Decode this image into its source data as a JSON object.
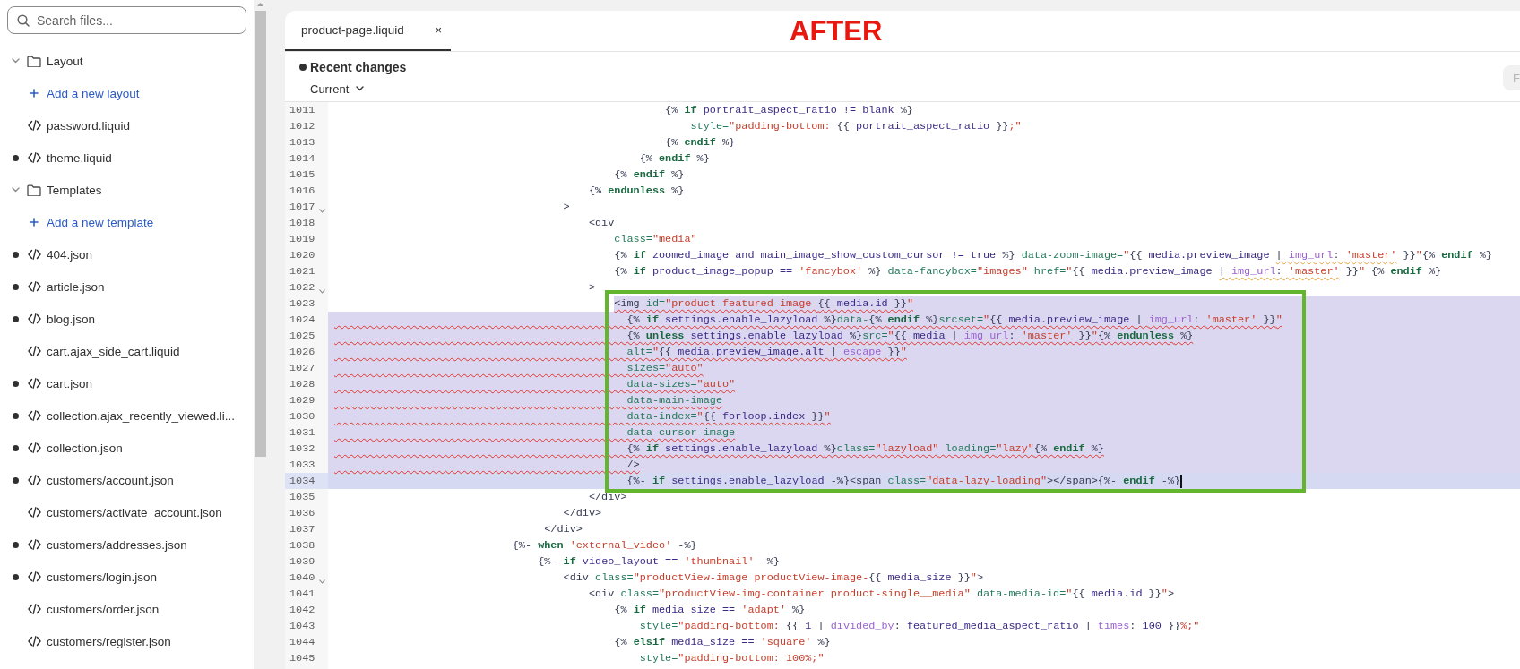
{
  "sidebar": {
    "search": {
      "placeholder": "Search files..."
    },
    "tree": [
      {
        "kind": "folder",
        "label": "Layout",
        "expanded": true,
        "children": [
          {
            "kind": "add",
            "label": "Add a new layout"
          },
          {
            "kind": "file",
            "label": "password.liquid",
            "modified": false
          },
          {
            "kind": "file",
            "label": "theme.liquid",
            "modified": true
          }
        ]
      },
      {
        "kind": "folder",
        "label": "Templates",
        "expanded": true,
        "children": [
          {
            "kind": "add",
            "label": "Add a new template"
          },
          {
            "kind": "file",
            "label": "404.json",
            "modified": true
          },
          {
            "kind": "file",
            "label": "article.json",
            "modified": true
          },
          {
            "kind": "file",
            "label": "blog.json",
            "modified": true
          },
          {
            "kind": "file",
            "label": "cart.ajax_side_cart.liquid",
            "modified": false
          },
          {
            "kind": "file",
            "label": "cart.json",
            "modified": true
          },
          {
            "kind": "file",
            "label": "collection.ajax_recently_viewed.li...",
            "modified": true
          },
          {
            "kind": "file",
            "label": "collection.json",
            "modified": true
          },
          {
            "kind": "file",
            "label": "customers/account.json",
            "modified": true
          },
          {
            "kind": "file",
            "label": "customers/activate_account.json",
            "modified": false
          },
          {
            "kind": "file",
            "label": "customers/addresses.json",
            "modified": true
          },
          {
            "kind": "file",
            "label": "customers/login.json",
            "modified": true
          },
          {
            "kind": "file",
            "label": "customers/order.json",
            "modified": false
          },
          {
            "kind": "file",
            "label": "customers/register.json",
            "modified": false
          }
        ]
      }
    ]
  },
  "editor": {
    "tabs": [
      {
        "label": "product-page.liquid",
        "close": "×",
        "selected": true
      }
    ],
    "annotation_label": "AFTER",
    "changes": {
      "unsaved": true,
      "title": "Recent changes",
      "version": "Current"
    },
    "toolbar_button": "F",
    "lines": [
      {
        "number": "1011",
        "current": false,
        "foldable": false,
        "selected": false,
        "partial": false,
        "squiggle": false,
        "tokens": [
          {
            "kind": "punct",
            "text": "                                                    {% "
          },
          {
            "kind": "keyword",
            "text": "if"
          },
          {
            "kind": "name",
            "text": " portrait_aspect_ratio != blank "
          },
          {
            "kind": "punct",
            "text": "%}"
          }
        ]
      },
      {
        "number": "1012",
        "current": false,
        "foldable": false,
        "selected": false,
        "partial": false,
        "squiggle": false,
        "tokens": [
          {
            "kind": "attr",
            "text": "                                                        style="
          },
          {
            "kind": "string",
            "text": "\"padding-bottom: "
          },
          {
            "kind": "punct",
            "text": "{{"
          },
          {
            "kind": "name",
            "text": " portrait_aspect_ratio "
          },
          {
            "kind": "punct",
            "text": "}}"
          },
          {
            "kind": "string",
            "text": ";\""
          }
        ]
      },
      {
        "number": "1013",
        "current": false,
        "foldable": false,
        "selected": false,
        "partial": false,
        "squiggle": false,
        "tokens": [
          {
            "kind": "punct",
            "text": "                                                    {% "
          },
          {
            "kind": "keyword",
            "text": "endif"
          },
          {
            "kind": "punct",
            "text": " %}"
          }
        ]
      },
      {
        "number": "1014",
        "current": false,
        "foldable": false,
        "selected": false,
        "partial": false,
        "squiggle": false,
        "tokens": [
          {
            "kind": "punct",
            "text": "                                                {% "
          },
          {
            "kind": "keyword",
            "text": "endif"
          },
          {
            "kind": "punct",
            "text": " %}"
          }
        ]
      },
      {
        "number": "1015",
        "current": false,
        "foldable": false,
        "selected": false,
        "partial": false,
        "squiggle": false,
        "tokens": [
          {
            "kind": "punct",
            "text": "                                            {% "
          },
          {
            "kind": "keyword",
            "text": "endif"
          },
          {
            "kind": "punct",
            "text": " %}"
          }
        ]
      },
      {
        "number": "1016",
        "current": false,
        "foldable": false,
        "selected": false,
        "partial": false,
        "squiggle": false,
        "tokens": [
          {
            "kind": "punct",
            "text": "                                        {% "
          },
          {
            "kind": "keyword",
            "text": "endunless"
          },
          {
            "kind": "punct",
            "text": " %}"
          }
        ]
      },
      {
        "number": "1017",
        "current": false,
        "foldable": true,
        "selected": false,
        "partial": false,
        "squiggle": false,
        "tokens": [
          {
            "kind": "punct",
            "text": "                                    >"
          }
        ]
      },
      {
        "number": "1018",
        "current": false,
        "foldable": false,
        "selected": false,
        "partial": false,
        "squiggle": false,
        "tokens": [
          {
            "kind": "punct",
            "text": "                                        <div"
          }
        ]
      },
      {
        "number": "1019",
        "current": false,
        "foldable": false,
        "selected": false,
        "partial": false,
        "squiggle": false,
        "tokens": [
          {
            "kind": "attr",
            "text": "                                            class="
          },
          {
            "kind": "string",
            "text": "\"media\""
          }
        ]
      },
      {
        "number": "1020",
        "current": false,
        "foldable": false,
        "selected": false,
        "partial": false,
        "squiggle": false,
        "tokens": [
          {
            "kind": "punct",
            "text": "                                            {% "
          },
          {
            "kind": "keyword",
            "text": "if"
          },
          {
            "kind": "name",
            "text": " zoomed_image and main_image_show_custom_cursor != true "
          },
          {
            "kind": "punct",
            "text": "%}"
          },
          {
            "kind": "attr",
            "text": " data-zoom-image="
          },
          {
            "kind": "string",
            "text": "\""
          },
          {
            "kind": "punct",
            "text": "{{"
          },
          {
            "kind": "name",
            "text": " media.preview_image "
          },
          {
            "kind": "punct",
            "text": "| ",
            "warning": true
          },
          {
            "kind": "filter",
            "text": "img_url",
            "warning": true
          },
          {
            "kind": "punct",
            "text": ": ",
            "warning": true
          },
          {
            "kind": "string",
            "text": "'master'",
            "warning": true
          },
          {
            "kind": "punct",
            "text": " }}"
          },
          {
            "kind": "string",
            "text": "\""
          },
          {
            "kind": "punct",
            "text": "{% "
          },
          {
            "kind": "keyword",
            "text": "endif"
          },
          {
            "kind": "punct",
            "text": " %}"
          }
        ]
      },
      {
        "number": "1021",
        "current": false,
        "foldable": false,
        "selected": false,
        "partial": false,
        "squiggle": false,
        "tokens": [
          {
            "kind": "punct",
            "text": "                                            {% "
          },
          {
            "kind": "keyword",
            "text": "if"
          },
          {
            "kind": "name",
            "text": " product_image_popup == "
          },
          {
            "kind": "string",
            "text": "'fancybox'"
          },
          {
            "kind": "punct",
            "text": " %}"
          },
          {
            "kind": "attr",
            "text": " data-fancybox="
          },
          {
            "kind": "string",
            "text": "\"images\""
          },
          {
            "kind": "attr",
            "text": " href="
          },
          {
            "kind": "string",
            "text": "\""
          },
          {
            "kind": "punct",
            "text": "{{"
          },
          {
            "kind": "name",
            "text": " media.preview_image "
          },
          {
            "kind": "punct",
            "text": "| ",
            "warning": true
          },
          {
            "kind": "filter",
            "text": "img_url",
            "warning": true
          },
          {
            "kind": "punct",
            "text": ": ",
            "warning": true
          },
          {
            "kind": "string",
            "text": "'master'",
            "warning": true
          },
          {
            "kind": "punct",
            "text": " }}"
          },
          {
            "kind": "string",
            "text": "\""
          },
          {
            "kind": "punct",
            "text": " {% "
          },
          {
            "kind": "keyword",
            "text": "endif"
          },
          {
            "kind": "punct",
            "text": " %}"
          }
        ]
      },
      {
        "number": "1022",
        "current": false,
        "foldable": true,
        "selected": false,
        "partial": false,
        "squiggle": false,
        "tokens": [
          {
            "kind": "punct",
            "text": "                                        >"
          }
        ]
      },
      {
        "number": "1023",
        "current": false,
        "foldable": false,
        "selected": true,
        "partial": true,
        "squiggle": true,
        "tokens": [
          {
            "kind": "punct",
            "text": "                                            <img"
          },
          {
            "kind": "attr",
            "text": " id="
          },
          {
            "kind": "string",
            "text": "\"product-featured-image-"
          },
          {
            "kind": "punct",
            "text": "{{"
          },
          {
            "kind": "name",
            "text": " media.id "
          },
          {
            "kind": "punct",
            "text": "}}"
          },
          {
            "kind": "string",
            "text": "\""
          }
        ]
      },
      {
        "number": "1024",
        "current": false,
        "foldable": false,
        "selected": true,
        "partial": false,
        "squiggle": true,
        "tokens": [
          {
            "kind": "punct",
            "text": "                                              {% "
          },
          {
            "kind": "keyword",
            "text": "if"
          },
          {
            "kind": "name",
            "text": " settings.enable_lazyload "
          },
          {
            "kind": "punct",
            "text": "%}"
          },
          {
            "kind": "attr",
            "text": "data-"
          },
          {
            "kind": "punct",
            "text": "{% "
          },
          {
            "kind": "keyword",
            "text": "endif"
          },
          {
            "kind": "punct",
            "text": " %}"
          },
          {
            "kind": "attr",
            "text": "srcset="
          },
          {
            "kind": "string",
            "text": "\""
          },
          {
            "kind": "punct",
            "text": "{{"
          },
          {
            "kind": "name",
            "text": " media.preview_image "
          },
          {
            "kind": "punct",
            "text": "| "
          },
          {
            "kind": "filter",
            "text": "img_url"
          },
          {
            "kind": "punct",
            "text": ": "
          },
          {
            "kind": "string",
            "text": "'master'"
          },
          {
            "kind": "punct",
            "text": " }}"
          },
          {
            "kind": "string",
            "text": "\""
          }
        ]
      },
      {
        "number": "1025",
        "current": false,
        "foldable": false,
        "selected": true,
        "partial": false,
        "squiggle": true,
        "tokens": [
          {
            "kind": "punct",
            "text": "                                              {% "
          },
          {
            "kind": "keyword",
            "text": "unless"
          },
          {
            "kind": "name",
            "text": " settings.enable_lazyload "
          },
          {
            "kind": "punct",
            "text": "%}"
          },
          {
            "kind": "attr",
            "text": "src="
          },
          {
            "kind": "string",
            "text": "\""
          },
          {
            "kind": "punct",
            "text": "{{"
          },
          {
            "kind": "name",
            "text": " media "
          },
          {
            "kind": "punct",
            "text": "| "
          },
          {
            "kind": "filter",
            "text": "img_url"
          },
          {
            "kind": "punct",
            "text": ": "
          },
          {
            "kind": "string",
            "text": "'master'"
          },
          {
            "kind": "punct",
            "text": " }}"
          },
          {
            "kind": "string",
            "text": "\""
          },
          {
            "kind": "punct",
            "text": "{% "
          },
          {
            "kind": "keyword",
            "text": "endunless"
          },
          {
            "kind": "punct",
            "text": " %}"
          }
        ]
      },
      {
        "number": "1026",
        "current": false,
        "foldable": false,
        "selected": true,
        "partial": false,
        "squiggle": true,
        "tokens": [
          {
            "kind": "attr",
            "text": "                                              alt="
          },
          {
            "kind": "string",
            "text": "\""
          },
          {
            "kind": "punct",
            "text": "{{"
          },
          {
            "kind": "name",
            "text": " media.preview_image.alt "
          },
          {
            "kind": "punct",
            "text": "| "
          },
          {
            "kind": "filter",
            "text": "escape"
          },
          {
            "kind": "punct",
            "text": " }}"
          },
          {
            "kind": "string",
            "text": "\""
          }
        ]
      },
      {
        "number": "1027",
        "current": false,
        "foldable": false,
        "selected": true,
        "partial": false,
        "squiggle": true,
        "tokens": [
          {
            "kind": "attr",
            "text": "                                              sizes="
          },
          {
            "kind": "string",
            "text": "\"auto\""
          }
        ]
      },
      {
        "number": "1028",
        "current": false,
        "foldable": false,
        "selected": true,
        "partial": false,
        "squiggle": true,
        "tokens": [
          {
            "kind": "attr",
            "text": "                                              data-sizes="
          },
          {
            "kind": "string",
            "text": "\"auto\""
          }
        ]
      },
      {
        "number": "1029",
        "current": false,
        "foldable": false,
        "selected": true,
        "partial": false,
        "squiggle": true,
        "tokens": [
          {
            "kind": "attr",
            "text": "                                              data-main-image"
          }
        ]
      },
      {
        "number": "1030",
        "current": false,
        "foldable": false,
        "selected": true,
        "partial": false,
        "squiggle": true,
        "tokens": [
          {
            "kind": "attr",
            "text": "                                              data-index="
          },
          {
            "kind": "string",
            "text": "\""
          },
          {
            "kind": "punct",
            "text": "{{"
          },
          {
            "kind": "name",
            "text": " forloop.index "
          },
          {
            "kind": "punct",
            "text": "}}"
          },
          {
            "kind": "string",
            "text": "\""
          }
        ]
      },
      {
        "number": "1031",
        "current": false,
        "foldable": false,
        "selected": true,
        "partial": false,
        "squiggle": true,
        "tokens": [
          {
            "kind": "attr",
            "text": "                                              data-cursor-image"
          }
        ]
      },
      {
        "number": "1032",
        "current": false,
        "foldable": false,
        "selected": true,
        "partial": false,
        "squiggle": true,
        "tokens": [
          {
            "kind": "punct",
            "text": "                                              {% "
          },
          {
            "kind": "keyword",
            "text": "if"
          },
          {
            "kind": "name",
            "text": " settings.enable_lazyload "
          },
          {
            "kind": "punct",
            "text": "%}"
          },
          {
            "kind": "attr",
            "text": "class="
          },
          {
            "kind": "string",
            "text": "\"lazyload\""
          },
          {
            "kind": "attr",
            "text": " loading="
          },
          {
            "kind": "string",
            "text": "\"lazy\""
          },
          {
            "kind": "punct",
            "text": "{% "
          },
          {
            "kind": "keyword",
            "text": "endif"
          },
          {
            "kind": "punct",
            "text": " %}"
          }
        ]
      },
      {
        "number": "1033",
        "current": false,
        "foldable": false,
        "selected": true,
        "partial": false,
        "squiggle": true,
        "tokens": [
          {
            "kind": "punct",
            "text": "                                              />"
          }
        ]
      },
      {
        "number": "1034",
        "current": true,
        "foldable": false,
        "selected": true,
        "partial": false,
        "squiggle": false,
        "tokens": [
          {
            "kind": "punct",
            "text": "                                              {%- "
          },
          {
            "kind": "keyword",
            "text": "if"
          },
          {
            "kind": "name",
            "text": " settings.enable_lazyload "
          },
          {
            "kind": "punct",
            "text": "-%}<span"
          },
          {
            "kind": "attr",
            "text": " class="
          },
          {
            "kind": "string",
            "text": "\"data-lazy-loading\""
          },
          {
            "kind": "punct",
            "text": "></span>{%- "
          },
          {
            "kind": "keyword",
            "text": "endif"
          },
          {
            "kind": "punct",
            "text": " -%}"
          }
        ]
      },
      {
        "number": "1035",
        "current": false,
        "foldable": false,
        "selected": false,
        "partial": false,
        "squiggle": false,
        "tokens": [
          {
            "kind": "punct",
            "text": "                                        </div>"
          }
        ]
      },
      {
        "number": "1036",
        "current": false,
        "foldable": false,
        "selected": false,
        "partial": false,
        "squiggle": false,
        "tokens": [
          {
            "kind": "punct",
            "text": "                                    </div>"
          }
        ]
      },
      {
        "number": "1037",
        "current": false,
        "foldable": false,
        "selected": false,
        "partial": false,
        "squiggle": false,
        "tokens": [
          {
            "kind": "punct",
            "text": "                                 </div>"
          }
        ]
      },
      {
        "number": "1038",
        "current": false,
        "foldable": false,
        "selected": false,
        "partial": false,
        "squiggle": false,
        "tokens": [
          {
            "kind": "punct",
            "text": "                            {%- "
          },
          {
            "kind": "keyword",
            "text": "when"
          },
          {
            "kind": "string",
            "text": " 'external_video'"
          },
          {
            "kind": "punct",
            "text": " -%}"
          }
        ]
      },
      {
        "number": "1039",
        "current": false,
        "foldable": false,
        "selected": false,
        "partial": false,
        "squiggle": false,
        "tokens": [
          {
            "kind": "punct",
            "text": "                                {%- "
          },
          {
            "kind": "keyword",
            "text": "if"
          },
          {
            "kind": "name",
            "text": " video_layout == "
          },
          {
            "kind": "string",
            "text": "'thumbnail'"
          },
          {
            "kind": "punct",
            "text": " -%}"
          }
        ]
      },
      {
        "number": "1040",
        "current": false,
        "foldable": true,
        "selected": false,
        "partial": false,
        "squiggle": false,
        "tokens": [
          {
            "kind": "punct",
            "text": "                                    <div"
          },
          {
            "kind": "attr",
            "text": " class="
          },
          {
            "kind": "string",
            "text": "\"productView-image productView-image-"
          },
          {
            "kind": "punct",
            "text": "{{"
          },
          {
            "kind": "name",
            "text": " media_size "
          },
          {
            "kind": "punct",
            "text": "}}"
          },
          {
            "kind": "string",
            "text": "\""
          },
          {
            "kind": "punct",
            "text": ">"
          }
        ]
      },
      {
        "number": "1041",
        "current": false,
        "foldable": false,
        "selected": false,
        "partial": false,
        "squiggle": false,
        "tokens": [
          {
            "kind": "punct",
            "text": "                                        <div"
          },
          {
            "kind": "attr",
            "text": " class="
          },
          {
            "kind": "string",
            "text": "\"productView-img-container product-single__media\""
          },
          {
            "kind": "attr",
            "text": " data-media-id="
          },
          {
            "kind": "string",
            "text": "\""
          },
          {
            "kind": "punct",
            "text": "{{"
          },
          {
            "kind": "name",
            "text": " media.id "
          },
          {
            "kind": "punct",
            "text": "}}"
          },
          {
            "kind": "string",
            "text": "\""
          },
          {
            "kind": "punct",
            "text": ">"
          }
        ]
      },
      {
        "number": "1042",
        "current": false,
        "foldable": false,
        "selected": false,
        "partial": false,
        "squiggle": false,
        "tokens": [
          {
            "kind": "punct",
            "text": "                                            {% "
          },
          {
            "kind": "keyword",
            "text": "if"
          },
          {
            "kind": "name",
            "text": " media_size == "
          },
          {
            "kind": "string",
            "text": "'adapt'"
          },
          {
            "kind": "punct",
            "text": " %}"
          }
        ]
      },
      {
        "number": "1043",
        "current": false,
        "foldable": false,
        "selected": false,
        "partial": false,
        "squiggle": false,
        "tokens": [
          {
            "kind": "attr",
            "text": "                                                style="
          },
          {
            "kind": "string",
            "text": "\"padding-bottom: "
          },
          {
            "kind": "punct",
            "text": "{{"
          },
          {
            "kind": "name",
            "text": " 1 "
          },
          {
            "kind": "punct",
            "text": "| "
          },
          {
            "kind": "filter",
            "text": "divided_by"
          },
          {
            "kind": "punct",
            "text": ":"
          },
          {
            "kind": "name",
            "text": " featured_media_aspect_ratio "
          },
          {
            "kind": "punct",
            "text": "| "
          },
          {
            "kind": "filter",
            "text": "times"
          },
          {
            "kind": "punct",
            "text": ":"
          },
          {
            "kind": "name",
            "text": " 100 "
          },
          {
            "kind": "punct",
            "text": "}}"
          },
          {
            "kind": "string",
            "text": "%;\""
          }
        ]
      },
      {
        "number": "1044",
        "current": false,
        "foldable": false,
        "selected": false,
        "partial": false,
        "squiggle": false,
        "tokens": [
          {
            "kind": "punct",
            "text": "                                            {% "
          },
          {
            "kind": "keyword",
            "text": "elsif"
          },
          {
            "kind": "name",
            "text": " media_size == "
          },
          {
            "kind": "string",
            "text": "'square'"
          },
          {
            "kind": "punct",
            "text": " %}"
          }
        ]
      },
      {
        "number": "1045",
        "current": false,
        "foldable": false,
        "selected": false,
        "partial": false,
        "squiggle": false,
        "tokens": [
          {
            "kind": "attr",
            "text": "                                                style="
          },
          {
            "kind": "string",
            "text": "\"padding-bottom: 100%;\""
          }
        ]
      }
    ]
  }
}
